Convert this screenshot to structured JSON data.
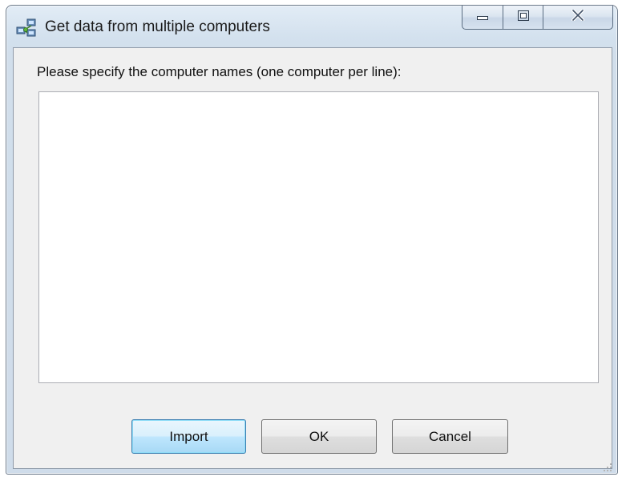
{
  "window": {
    "title": "Get data from multiple computers",
    "title_icon": "network-computers-icon",
    "caption_buttons": {
      "minimize_icon": "minimize-icon",
      "maximize_icon": "maximize-icon",
      "close_icon": "close-icon"
    }
  },
  "form": {
    "prompt_label": "Please specify the computer names (one computer per line):",
    "names_value": ""
  },
  "buttons": {
    "import_label": "Import",
    "ok_label": "OK",
    "cancel_label": "Cancel"
  },
  "colors": {
    "frame": "#d3e1ee",
    "client_bg": "#f0f0f0",
    "focus_accent": "#3c7fb1"
  }
}
